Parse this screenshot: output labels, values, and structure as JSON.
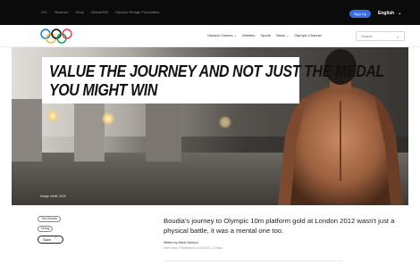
{
  "topbar": {
    "links": [
      "IOC",
      "Museum",
      "Shop",
      "Athlete365",
      "Olympic Refuge Foundation"
    ],
    "signup_label": "Sign Up",
    "language": "English"
  },
  "nav": {
    "links": [
      {
        "label": "Olympic Games",
        "dropdown": true,
        "active": false
      },
      {
        "label": "Athletes",
        "dropdown": false,
        "active": false
      },
      {
        "label": "Sports",
        "dropdown": false,
        "active": false
      },
      {
        "label": "News",
        "dropdown": true,
        "active": true
      },
      {
        "label": "Olympic Channel",
        "dropdown": false,
        "active": false
      }
    ],
    "search_placeholder": "Search",
    "ring_colors": [
      "#0081c8",
      "#fcb131",
      "#000000",
      "#00a651",
      "#ee334e"
    ],
    "accent": "#3a6ee0"
  },
  "hero": {
    "headline_line1": "VALUE THE JOURNEY AND NOT JUST THE MEDAL",
    "headline_line2": "YOU MIGHT WIN",
    "credit": "Image credit: 2020"
  },
  "tags": [
    "Tom Boudia",
    "Diving"
  ],
  "save_label": "Save",
  "article": {
    "lead": "Boudia's journey to Olympic 10m platform gold at London 2012 wasn't just a physical battle, it was a mental one too.",
    "byline": "Written by Mark Harrison",
    "dateline": "6 min read | Published on 01/04/2021 | 2:35pm"
  }
}
